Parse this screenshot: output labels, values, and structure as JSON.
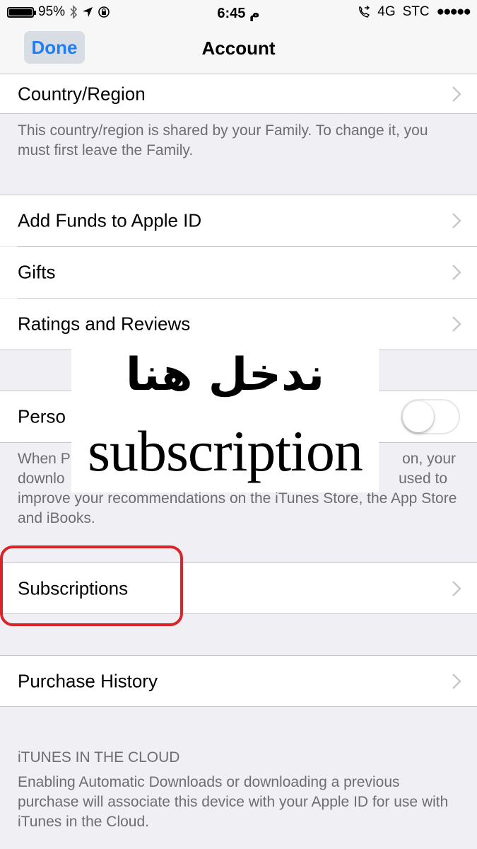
{
  "status_bar": {
    "battery": "95%",
    "battery_level": 0.95,
    "time": "6:45 م",
    "network": "4G",
    "carrier": "STC",
    "signal_dots": "●●●●●"
  },
  "nav": {
    "done_label": "Done",
    "title": "Account"
  },
  "rows": {
    "country_region": "Country/Region",
    "add_funds": "Add Funds to Apple ID",
    "gifts": "Gifts",
    "ratings_reviews": "Ratings and Reviews",
    "personalized": "Perso",
    "subscriptions": "Subscriptions",
    "purchase_history": "Purchase History"
  },
  "footers": {
    "family_note": "This country/region is shared by your Family. To change it, you must first leave the Family.",
    "personalized_note_line1_start": "When P",
    "personalized_note_line1_end": "on, your",
    "personalized_note_line2_start": "downlo",
    "personalized_note_line2_end": "used to",
    "personalized_note_rest": "improve your recommendations on the iTunes Store, the App Store and iBooks.",
    "itunes_cloud_header": "iTUNES IN THE CLOUD",
    "itunes_cloud_note": "Enabling Automatic Downloads or downloading a previous purchase will associate this device with your Apple ID for use with iTunes in the Cloud."
  },
  "toggle": {
    "personalized_on": false
  },
  "annotation": {
    "arabic": "ندخل هنا",
    "english": "subscription",
    "highlight_color": "#d9252a"
  },
  "colors": {
    "accent": "#1f7ef5",
    "background": "#efeff4",
    "secondary_text": "#6d6d72"
  }
}
